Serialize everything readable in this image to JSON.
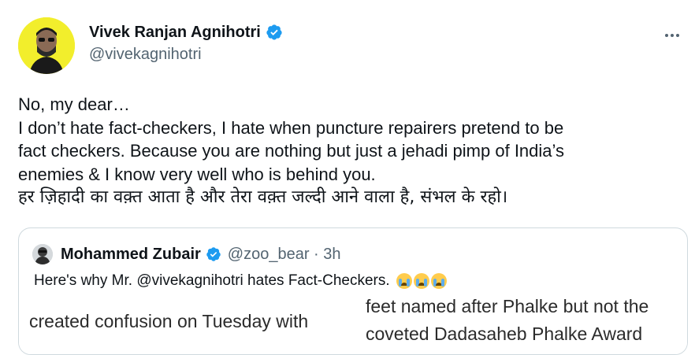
{
  "author": {
    "name": "Vivek Ranjan Agnihotri",
    "handle": "@vivekagnihotri",
    "verified": true
  },
  "tweet": {
    "lines": [
      "No, my dear…",
      "I don’t hate fact-checkers, I hate when puncture repairers pretend to be",
      "fact checkers. Because you are nothing but just a jehadi pimp of India’s",
      "enemies & I know very well who is behind you.",
      "हर ज़िहादी का वक़्त आता है और तेरा वक़्त जल्दी आने वाला है, संभल के रहो।"
    ]
  },
  "quote": {
    "name": "Mohammed Zubair",
    "handle": "@zoo_bear · 3h",
    "text": "Here's why Mr. @vivekagnihotri hates Fact-Checkers.",
    "emoji_count": 3,
    "media_text": {
      "left": "created confusion on Tuesday with",
      "right_top": "feet named after Phalke but not the",
      "right_bottom": "coveted Dadasaheb Phalke Award"
    }
  },
  "colors": {
    "verified": "#1d9bf0",
    "secondary_text": "#536471",
    "border": "#cfd9de"
  }
}
